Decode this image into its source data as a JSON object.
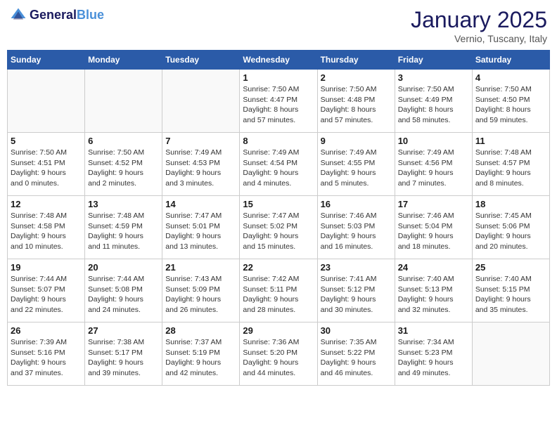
{
  "header": {
    "logo_line1": "General",
    "logo_line2": "Blue",
    "month": "January 2025",
    "location": "Vernio, Tuscany, Italy"
  },
  "weekdays": [
    "Sunday",
    "Monday",
    "Tuesday",
    "Wednesday",
    "Thursday",
    "Friday",
    "Saturday"
  ],
  "weeks": [
    [
      {
        "day": "",
        "info": ""
      },
      {
        "day": "",
        "info": ""
      },
      {
        "day": "",
        "info": ""
      },
      {
        "day": "1",
        "info": "Sunrise: 7:50 AM\nSunset: 4:47 PM\nDaylight: 8 hours\nand 57 minutes."
      },
      {
        "day": "2",
        "info": "Sunrise: 7:50 AM\nSunset: 4:48 PM\nDaylight: 8 hours\nand 57 minutes."
      },
      {
        "day": "3",
        "info": "Sunrise: 7:50 AM\nSunset: 4:49 PM\nDaylight: 8 hours\nand 58 minutes."
      },
      {
        "day": "4",
        "info": "Sunrise: 7:50 AM\nSunset: 4:50 PM\nDaylight: 8 hours\nand 59 minutes."
      }
    ],
    [
      {
        "day": "5",
        "info": "Sunrise: 7:50 AM\nSunset: 4:51 PM\nDaylight: 9 hours\nand 0 minutes."
      },
      {
        "day": "6",
        "info": "Sunrise: 7:50 AM\nSunset: 4:52 PM\nDaylight: 9 hours\nand 2 minutes."
      },
      {
        "day": "7",
        "info": "Sunrise: 7:49 AM\nSunset: 4:53 PM\nDaylight: 9 hours\nand 3 minutes."
      },
      {
        "day": "8",
        "info": "Sunrise: 7:49 AM\nSunset: 4:54 PM\nDaylight: 9 hours\nand 4 minutes."
      },
      {
        "day": "9",
        "info": "Sunrise: 7:49 AM\nSunset: 4:55 PM\nDaylight: 9 hours\nand 5 minutes."
      },
      {
        "day": "10",
        "info": "Sunrise: 7:49 AM\nSunset: 4:56 PM\nDaylight: 9 hours\nand 7 minutes."
      },
      {
        "day": "11",
        "info": "Sunrise: 7:48 AM\nSunset: 4:57 PM\nDaylight: 9 hours\nand 8 minutes."
      }
    ],
    [
      {
        "day": "12",
        "info": "Sunrise: 7:48 AM\nSunset: 4:58 PM\nDaylight: 9 hours\nand 10 minutes."
      },
      {
        "day": "13",
        "info": "Sunrise: 7:48 AM\nSunset: 4:59 PM\nDaylight: 9 hours\nand 11 minutes."
      },
      {
        "day": "14",
        "info": "Sunrise: 7:47 AM\nSunset: 5:01 PM\nDaylight: 9 hours\nand 13 minutes."
      },
      {
        "day": "15",
        "info": "Sunrise: 7:47 AM\nSunset: 5:02 PM\nDaylight: 9 hours\nand 15 minutes."
      },
      {
        "day": "16",
        "info": "Sunrise: 7:46 AM\nSunset: 5:03 PM\nDaylight: 9 hours\nand 16 minutes."
      },
      {
        "day": "17",
        "info": "Sunrise: 7:46 AM\nSunset: 5:04 PM\nDaylight: 9 hours\nand 18 minutes."
      },
      {
        "day": "18",
        "info": "Sunrise: 7:45 AM\nSunset: 5:06 PM\nDaylight: 9 hours\nand 20 minutes."
      }
    ],
    [
      {
        "day": "19",
        "info": "Sunrise: 7:44 AM\nSunset: 5:07 PM\nDaylight: 9 hours\nand 22 minutes."
      },
      {
        "day": "20",
        "info": "Sunrise: 7:44 AM\nSunset: 5:08 PM\nDaylight: 9 hours\nand 24 minutes."
      },
      {
        "day": "21",
        "info": "Sunrise: 7:43 AM\nSunset: 5:09 PM\nDaylight: 9 hours\nand 26 minutes."
      },
      {
        "day": "22",
        "info": "Sunrise: 7:42 AM\nSunset: 5:11 PM\nDaylight: 9 hours\nand 28 minutes."
      },
      {
        "day": "23",
        "info": "Sunrise: 7:41 AM\nSunset: 5:12 PM\nDaylight: 9 hours\nand 30 minutes."
      },
      {
        "day": "24",
        "info": "Sunrise: 7:40 AM\nSunset: 5:13 PM\nDaylight: 9 hours\nand 32 minutes."
      },
      {
        "day": "25",
        "info": "Sunrise: 7:40 AM\nSunset: 5:15 PM\nDaylight: 9 hours\nand 35 minutes."
      }
    ],
    [
      {
        "day": "26",
        "info": "Sunrise: 7:39 AM\nSunset: 5:16 PM\nDaylight: 9 hours\nand 37 minutes."
      },
      {
        "day": "27",
        "info": "Sunrise: 7:38 AM\nSunset: 5:17 PM\nDaylight: 9 hours\nand 39 minutes."
      },
      {
        "day": "28",
        "info": "Sunrise: 7:37 AM\nSunset: 5:19 PM\nDaylight: 9 hours\nand 42 minutes."
      },
      {
        "day": "29",
        "info": "Sunrise: 7:36 AM\nSunset: 5:20 PM\nDaylight: 9 hours\nand 44 minutes."
      },
      {
        "day": "30",
        "info": "Sunrise: 7:35 AM\nSunset: 5:22 PM\nDaylight: 9 hours\nand 46 minutes."
      },
      {
        "day": "31",
        "info": "Sunrise: 7:34 AM\nSunset: 5:23 PM\nDaylight: 9 hours\nand 49 minutes."
      },
      {
        "day": "",
        "info": ""
      }
    ]
  ]
}
